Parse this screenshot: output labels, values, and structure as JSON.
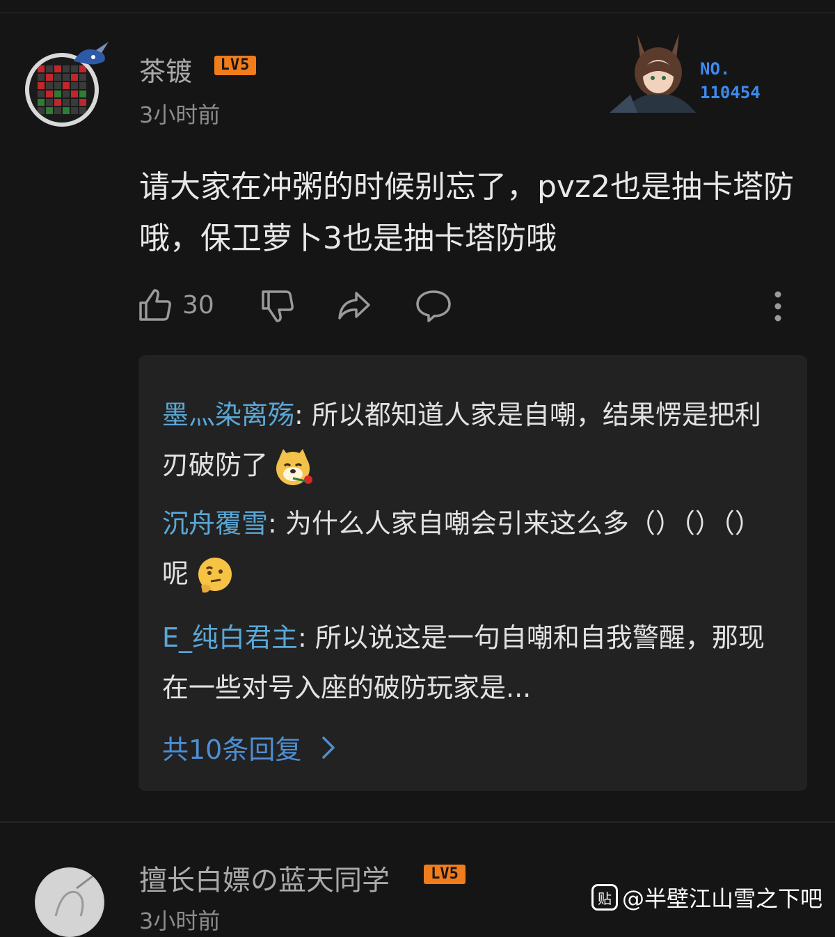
{
  "comment": {
    "username": "茶镀",
    "level": "LV5",
    "time": "3小时前",
    "card_label": "NO.",
    "card_number": "110454",
    "text": "请大家在冲粥的时候别忘了，pvz2也是抽卡塔防哦，保卫萝卜3也是抽卡塔防哦",
    "like_count": "30"
  },
  "replies": [
    {
      "name": "墨灬染离殇",
      "sep": ": ",
      "text": "所以都知道人家是自嘲，结果愣是把利刃破防了",
      "emoji": "doge-rose"
    },
    {
      "name": "沉舟覆雪",
      "sep": ": ",
      "text": "为什么人家自嘲会引来这么多（）（）（）呢",
      "emoji": "thinking-face"
    },
    {
      "name": "E_纯白君主",
      "sep": ": ",
      "text": "所以说这是一句自嘲和自我警醒，那现在一些对号入座的破防玩家是...",
      "emoji": ""
    }
  ],
  "more_replies": "共10条回复",
  "next_comment": {
    "username": "擅长白嫖の蓝天同学",
    "level": "LV5",
    "time": "3小时前"
  },
  "watermark": {
    "icon_text": "贴",
    "text": "@半壁江山雪之下吧"
  },
  "colors": {
    "background": "#151515",
    "reply_box": "#222222",
    "reply_name": "#5aa7d6",
    "link": "#4d8fd1",
    "level_badge": "#f07c1b",
    "card_number": "#3d8bf0"
  },
  "icons": [
    "thumb-up-icon",
    "thumb-down-icon",
    "share-icon",
    "comment-icon",
    "more-vertical-icon",
    "chevron-right-icon"
  ]
}
